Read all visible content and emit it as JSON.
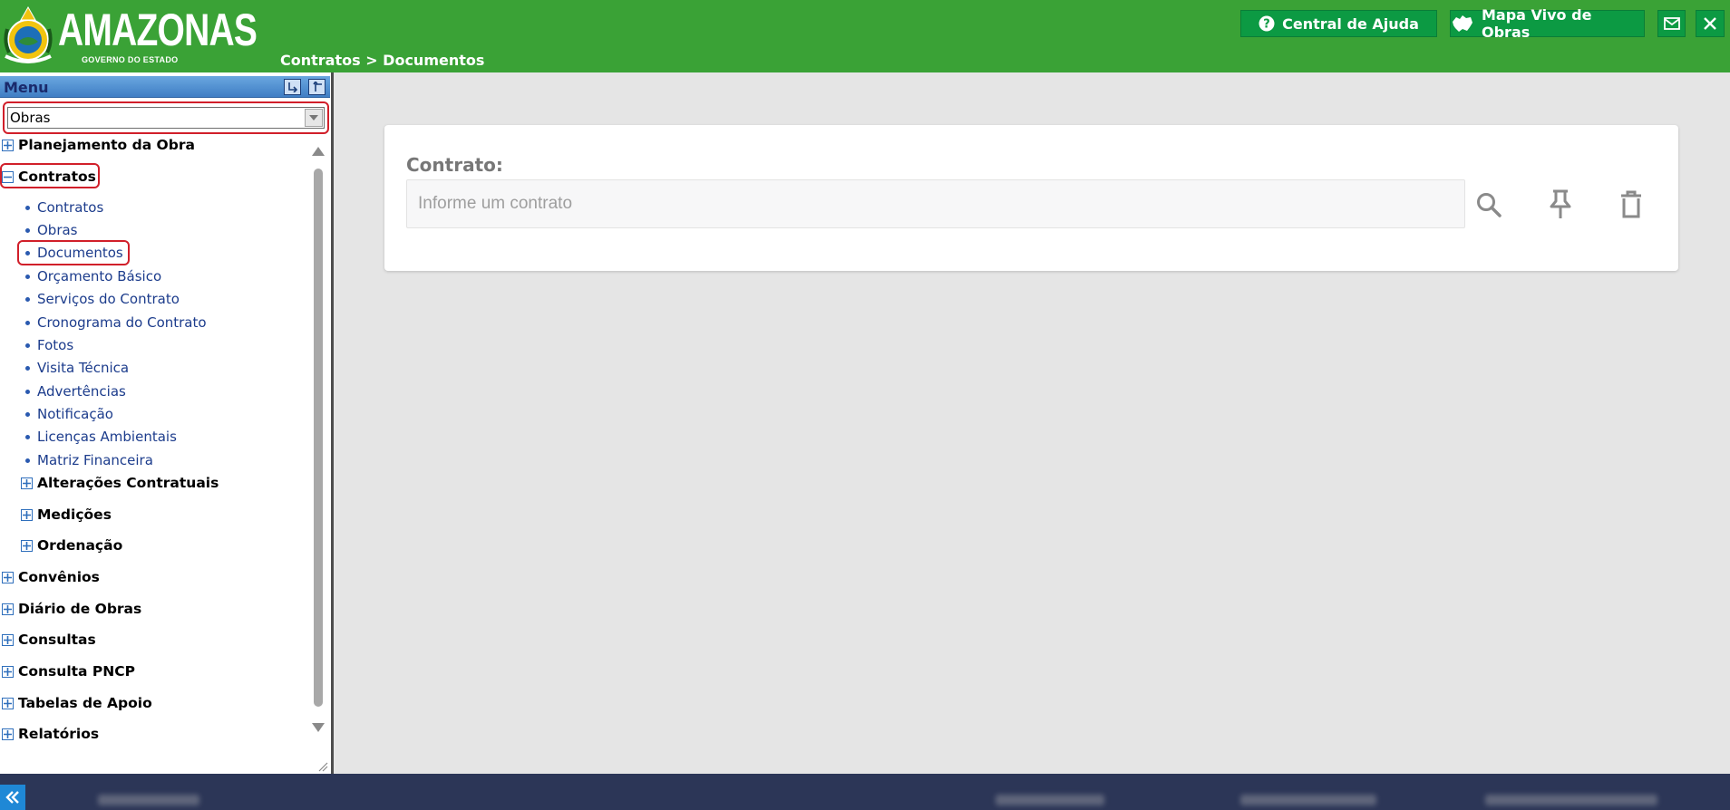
{
  "header": {
    "logo_text": "AMAZONAS",
    "logo_subtitle": "GOVERNO DO ESTADO",
    "breadcrumb": "Contratos > Documentos",
    "help_label": "Central de Ajuda",
    "mapa_label": "Mapa Vivo de Obras"
  },
  "sidebar": {
    "title": "Menu",
    "module_select": "Obras",
    "top_items": [
      {
        "label": "Planejamento da Obra",
        "expanded": false
      },
      {
        "label": "Contratos",
        "expanded": true
      }
    ],
    "contratos_children": [
      "Contratos",
      "Obras",
      "Documentos",
      "Orçamento Básico",
      "Serviços do Contrato",
      "Cronograma do Contrato",
      "Fotos",
      "Visita Técnica",
      "Advertências",
      "Notificação",
      "Licenças Ambientais",
      "Matriz Financeira"
    ],
    "contratos_subgroups": [
      "Alterações Contratuais",
      "Medições",
      "Ordenação"
    ],
    "bottom_items": [
      "Convênios",
      "Diário de Obras",
      "Consultas",
      "Consulta PNCP",
      "Tabelas de Apoio",
      "Relatórios"
    ]
  },
  "main": {
    "contrato_label": "Contrato:",
    "contrato_value": "",
    "contrato_placeholder": "Informe um contrato"
  },
  "colors": {
    "header_green": "#3aa236",
    "button_green": "#0c9a43",
    "footer_navy": "#2c3657",
    "highlight_red": "#d11f2a",
    "link_blue": "#1c3c8c"
  },
  "icons": {
    "help": "question-circle-icon",
    "mapa": "map-icon",
    "mail": "mail-icon",
    "close": "close-icon",
    "search": "search-icon",
    "pin": "pin-icon",
    "trash": "trash-icon"
  }
}
